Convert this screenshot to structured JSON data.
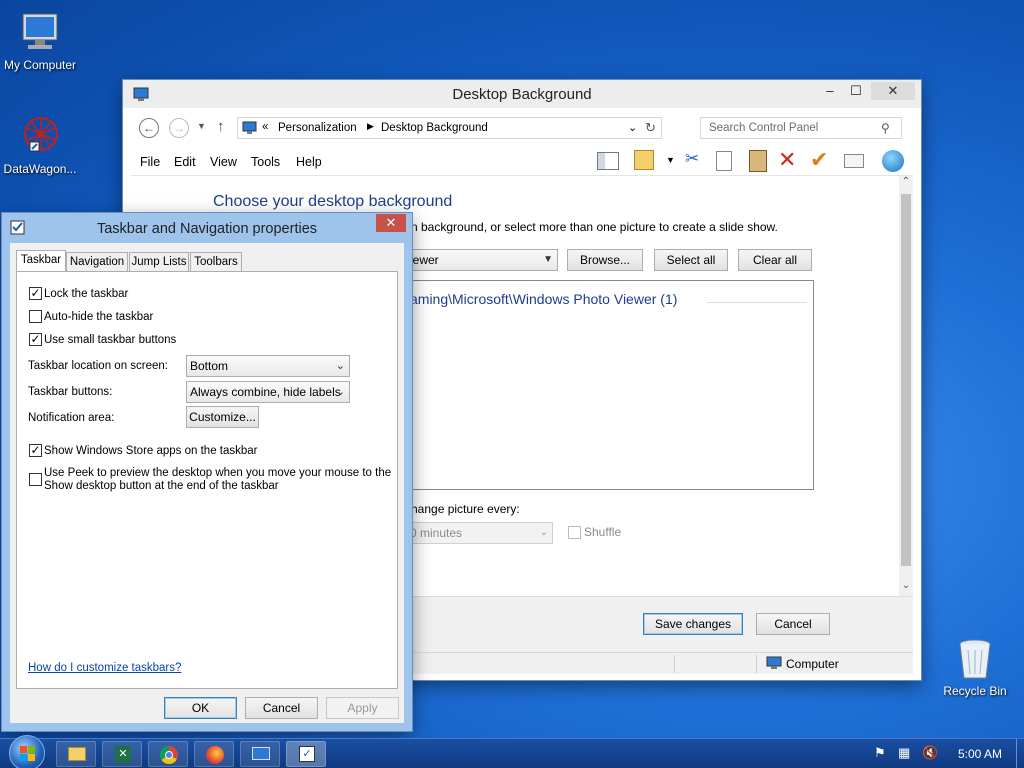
{
  "desktop": {
    "icons": [
      {
        "label": "My Computer"
      },
      {
        "label": "DataWagon..."
      },
      {
        "label": "Recycle Bin"
      }
    ]
  },
  "bg_window": {
    "title": "Desktop Background",
    "breadcrumb": [
      "Personalization",
      "Desktop Background"
    ],
    "breadcrumb_prefix": "«",
    "search_placeholder": "Search Control Panel",
    "menu": [
      "File",
      "Edit",
      "View",
      "Tools",
      "Help"
    ],
    "heading": "Choose your desktop background",
    "subheading": "n background, or select more than one picture to create a slide show.",
    "location_value": "iewer",
    "browse": "Browse...",
    "select_all": "Select all",
    "clear_all": "Clear all",
    "folder_path": "aming\\Microsoft\\Windows Photo Viewer (1)",
    "change_label": "hange picture every:",
    "interval": "0 minutes",
    "shuffle": "Shuffle",
    "save": "Save changes",
    "cancel": "Cancel",
    "status": "Computer"
  },
  "taskbar_dialog": {
    "title": "Taskbar and Navigation properties",
    "tabs": [
      "Taskbar",
      "Navigation",
      "Jump Lists",
      "Toolbars"
    ],
    "lock": "Lock the taskbar",
    "autohide": "Auto-hide the taskbar",
    "small": "Use small taskbar buttons",
    "location_label": "Taskbar location on screen:",
    "location_value": "Bottom",
    "buttons_label": "Taskbar buttons:",
    "buttons_value": "Always combine, hide labels",
    "notif_label": "Notification area:",
    "customize": "Customize...",
    "store": "Show Windows Store apps on the taskbar",
    "peek1": "Use Peek to preview the desktop when you move your mouse to the",
    "peek2": "Show desktop button at the end of the taskbar",
    "help_link": "How do I customize taskbars?",
    "ok": "OK",
    "cancel": "Cancel",
    "apply": "Apply"
  },
  "taskbar": {
    "clock": "5:00 AM"
  }
}
